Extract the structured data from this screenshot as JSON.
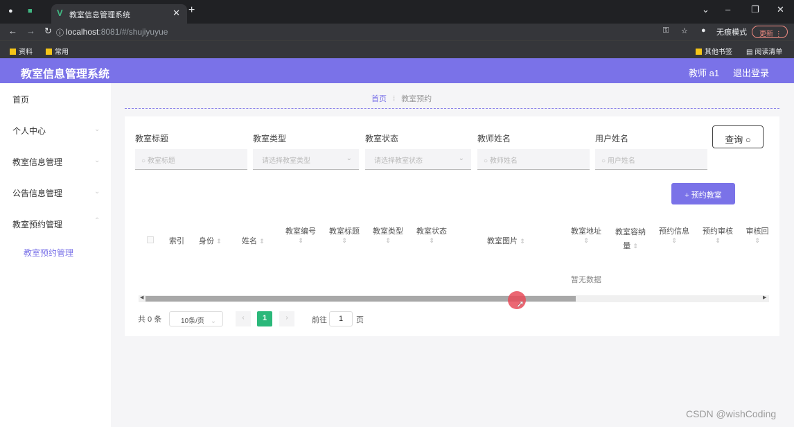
{
  "browser": {
    "tab_title": "教室信息管理系统",
    "url_host": "localhost",
    "url_path": ":8081/#/shujiyuyue",
    "incognito_label": "无痕模式",
    "update_label": "更新",
    "bookmarks": [
      "资料",
      "常用"
    ],
    "bookmarks_right": [
      "其他书签",
      "阅读清单"
    ]
  },
  "header": {
    "title": "教室信息管理系统",
    "user": "教师 a1",
    "logout": "退出登录"
  },
  "sidebar": {
    "items": [
      {
        "label": "首页"
      },
      {
        "label": "个人中心"
      },
      {
        "label": "教室信息管理"
      },
      {
        "label": "公告信息管理"
      },
      {
        "label": "教室预约管理"
      }
    ],
    "sub_item": "教室预约管理"
  },
  "breadcrumb": {
    "home": "首页",
    "current": "教室预约"
  },
  "filters": [
    {
      "label": "教室标题",
      "placeholder": "教室标题"
    },
    {
      "label": "教室类型",
      "placeholder": "请选择教室类型"
    },
    {
      "label": "教室状态",
      "placeholder": "请选择教室状态"
    },
    {
      "label": "教师姓名",
      "placeholder": "教师姓名"
    },
    {
      "label": "用户姓名",
      "placeholder": "用户姓名"
    }
  ],
  "buttons": {
    "query": "查询",
    "book": "+ 预约教室"
  },
  "table": {
    "columns": [
      "索引",
      "身份",
      "姓名",
      "教室编号",
      "教室标题",
      "教室类型",
      "教室状态",
      "教室图片",
      "教室地址",
      "教室容纳量",
      "预约信息",
      "预约审核",
      "审核回"
    ],
    "empty_text": "暂无数据"
  },
  "pagination": {
    "total": "共 0 条",
    "page_size": "10条/页",
    "current_page": "1",
    "goto_label": "前往",
    "goto_value": "1",
    "page_suffix": "页"
  },
  "watermark": "CSDN @wishCoding"
}
